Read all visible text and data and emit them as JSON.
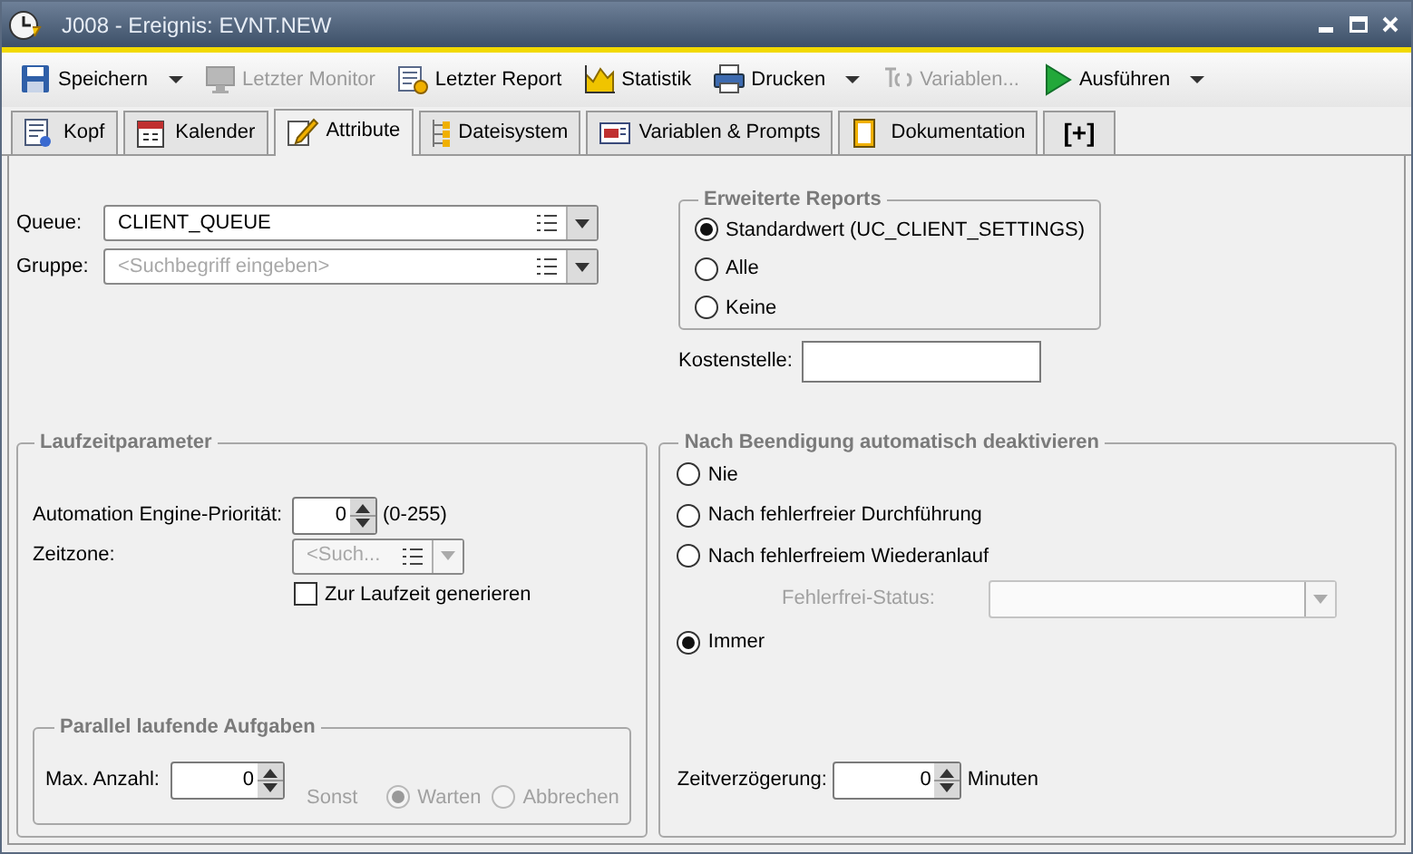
{
  "window": {
    "title": "J008 - Ereignis: EVNT.NEW"
  },
  "toolbar": [
    {
      "label": "Speichern",
      "disabled": false,
      "dropdown": true
    },
    {
      "label": "Letzter Monitor",
      "disabled": true,
      "dropdown": false
    },
    {
      "label": "Letzter Report",
      "disabled": false,
      "dropdown": false
    },
    {
      "label": "Statistik",
      "disabled": false,
      "dropdown": false
    },
    {
      "label": "Drucken",
      "disabled": false,
      "dropdown": true
    },
    {
      "label": "Variablen...",
      "disabled": true,
      "dropdown": false
    },
    {
      "label": "Ausführen",
      "disabled": false,
      "dropdown": true
    }
  ],
  "tabs": [
    {
      "label": "Kopf",
      "selected": false
    },
    {
      "label": "Kalender",
      "selected": false
    },
    {
      "label": "Attribute",
      "selected": true
    },
    {
      "label": "Dateisystem",
      "selected": false
    },
    {
      "label": "Variablen & Prompts",
      "selected": false
    },
    {
      "label": "Dokumentation",
      "selected": false
    },
    {
      "label": "[+]",
      "selected": false
    }
  ],
  "queue": {
    "label": "Queue:",
    "value": "CLIENT_QUEUE"
  },
  "gruppe": {
    "label": "Gruppe:",
    "placeholder": "<Suchbegriff eingeben>"
  },
  "erweiterte_reports": {
    "title": "Erweiterte Reports",
    "options": [
      {
        "label": "Standardwert (UC_CLIENT_SETTINGS)",
        "selected": true
      },
      {
        "label": "Alle",
        "selected": false
      },
      {
        "label": "Keine",
        "selected": false
      }
    ]
  },
  "kostenstelle": {
    "label": "Kostenstelle:"
  },
  "laufzeitparameter": {
    "title": "Laufzeitparameter",
    "prioritaet": {
      "label": "Automation Engine-Priorität:",
      "value": "0",
      "hint": "(0-255)"
    },
    "zeitzone": {
      "label": "Zeitzone:",
      "placeholder": "<Such...",
      "disabled": true
    },
    "generieren": {
      "label": "Zur Laufzeit generieren",
      "checked": false
    },
    "parallel": {
      "title": "Parallel laufende Aufgaben",
      "max_anzahl": {
        "label": "Max. Anzahl:",
        "value": "0"
      },
      "sonst": "Sonst",
      "disabled": true,
      "options": [
        {
          "label": "Warten",
          "selected": true
        },
        {
          "label": "Abbrechen",
          "selected": false
        }
      ]
    }
  },
  "deaktivieren": {
    "title": "Nach Beendigung automatisch deaktivieren",
    "items": [
      {
        "kind": "radio",
        "label": "Nie",
        "selected": false
      },
      {
        "kind": "radio",
        "label": "Nach fehlerfreier Durchführung",
        "selected": false
      },
      {
        "kind": "radio",
        "label": "Nach fehlerfreiem Wiederanlauf",
        "selected": false
      },
      {
        "kind": "select",
        "label": "Fehlerfrei-Status:",
        "disabled": true
      },
      {
        "kind": "radio",
        "label": "Immer",
        "selected": true
      }
    ],
    "zeitverzoegerung": {
      "label": "Zeitverzögerung:",
      "value": "0",
      "unit": "Minuten"
    }
  }
}
